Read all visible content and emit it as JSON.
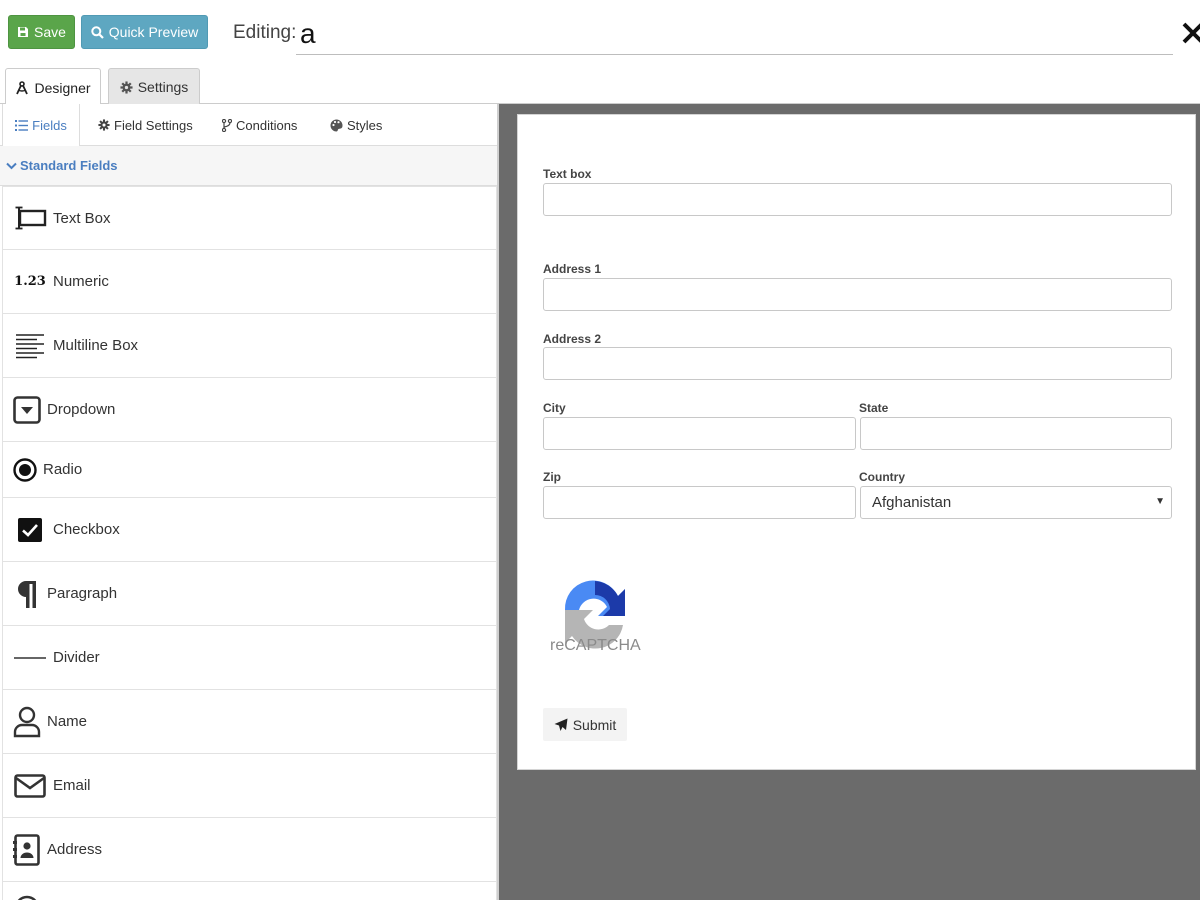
{
  "toolbar": {
    "save_label": "Save",
    "preview_label": "Quick Preview",
    "editing_label": "Editing:",
    "form_name": "a"
  },
  "main_tabs": [
    {
      "label": "Designer",
      "icon": "compass-icon",
      "active": true
    },
    {
      "label": "Settings",
      "icon": "gear-icon",
      "active": false
    }
  ],
  "sub_tabs": [
    {
      "label": "Fields",
      "icon": "list-icon",
      "active": true
    },
    {
      "label": "Field Settings",
      "icon": "gear-icon"
    },
    {
      "label": "Conditions",
      "icon": "branch-icon"
    },
    {
      "label": "Styles",
      "icon": "palette-icon"
    }
  ],
  "section": {
    "title": "Standard Fields"
  },
  "fields": [
    {
      "label": "Text Box",
      "icon": "text-box-icon"
    },
    {
      "label": "Numeric",
      "icon": "numeric-icon",
      "glyph": "1.23"
    },
    {
      "label": "Multiline Box",
      "icon": "multiline-icon"
    },
    {
      "label": "Dropdown",
      "icon": "dropdown-icon"
    },
    {
      "label": "Radio",
      "icon": "radio-icon"
    },
    {
      "label": "Checkbox",
      "icon": "checkbox-icon"
    },
    {
      "label": "Paragraph",
      "icon": "paragraph-icon"
    },
    {
      "label": "Divider",
      "icon": "divider-icon"
    },
    {
      "label": "Name",
      "icon": "user-icon"
    },
    {
      "label": "Email",
      "icon": "envelope-icon"
    },
    {
      "label": "Address",
      "icon": "address-book-icon"
    }
  ],
  "form": {
    "text_box_label": "Text box",
    "address1_label": "Address 1",
    "address2_label": "Address 2",
    "city_label": "City",
    "state_label": "State",
    "zip_label": "Zip",
    "country_label": "Country",
    "country_value": "Afghanistan",
    "recaptcha_text": "reCAPTCHA",
    "submit_label": "Submit"
  },
  "colors": {
    "save": "#5aa54a",
    "preview": "#5ea7c1",
    "accent": "#4a7ec0",
    "canvas_bg": "#6b6b6b"
  }
}
